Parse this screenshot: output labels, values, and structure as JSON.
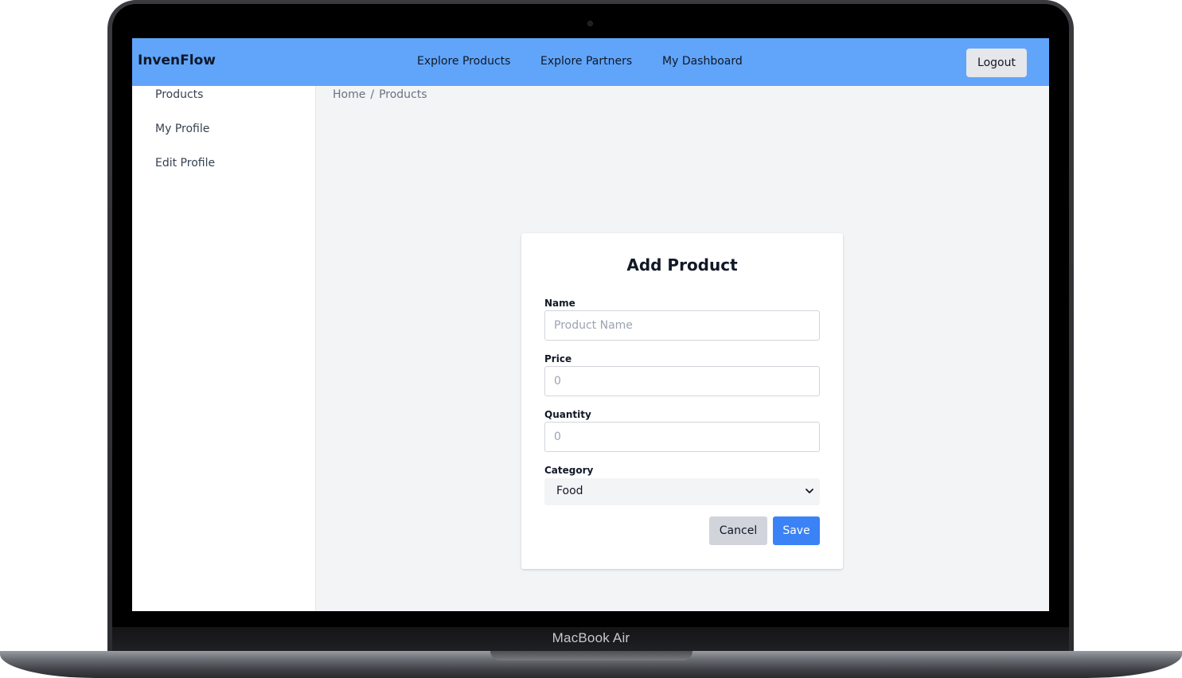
{
  "device": {
    "label": "MacBook Air"
  },
  "navbar": {
    "brand": "InvenFlow",
    "links": [
      "Explore Products",
      "Explore Partners",
      "My Dashboard"
    ],
    "logout_label": "Logout",
    "background": "#60a5fa"
  },
  "sidebar": {
    "items": [
      "Products",
      "My Profile",
      "Edit Profile"
    ]
  },
  "breadcrumb": {
    "items": [
      "Home",
      "Products"
    ],
    "separator": "/"
  },
  "form": {
    "title": "Add Product",
    "name": {
      "label": "Name",
      "placeholder": "Product Name",
      "value": ""
    },
    "price": {
      "label": "Price",
      "placeholder": "0",
      "value": ""
    },
    "quantity": {
      "label": "Quantity",
      "placeholder": "0",
      "value": ""
    },
    "category": {
      "label": "Category",
      "selected": "Food"
    },
    "cancel_label": "Cancel",
    "save_label": "Save",
    "save_color": "#3b82f6"
  }
}
